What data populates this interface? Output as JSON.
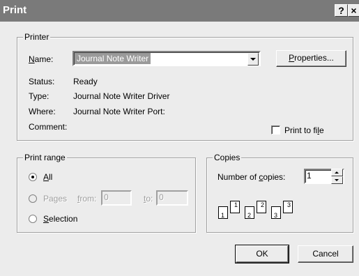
{
  "window": {
    "title": "Print",
    "help_label": "?",
    "close_label": "×"
  },
  "printer": {
    "group_label": "Printer",
    "name_label": "Name:",
    "name_value": "Journal Note Writer",
    "properties_label": "Properties...",
    "status_label": "Status:",
    "status_value": "Ready",
    "type_label": "Type:",
    "type_value": "Journal Note Writer Driver",
    "where_label": "Where:",
    "where_value": "Journal Note Writer Port:",
    "comment_label": "Comment:",
    "print_to_file_label": "Print to file",
    "print_to_file_checked": false
  },
  "print_range": {
    "group_label": "Print range",
    "all_label": "All",
    "pages_label": "Pages",
    "from_label": "from:",
    "from_value": "0",
    "to_label": "to:",
    "to_value": "0",
    "selection_label": "Selection",
    "selected": "all"
  },
  "copies": {
    "group_label": "Copies",
    "number_label": "Number of copies:",
    "number_value": "1",
    "collate_pages": [
      "1",
      "2",
      "3"
    ]
  },
  "buttons": {
    "ok_label": "OK",
    "cancel_label": "Cancel"
  }
}
